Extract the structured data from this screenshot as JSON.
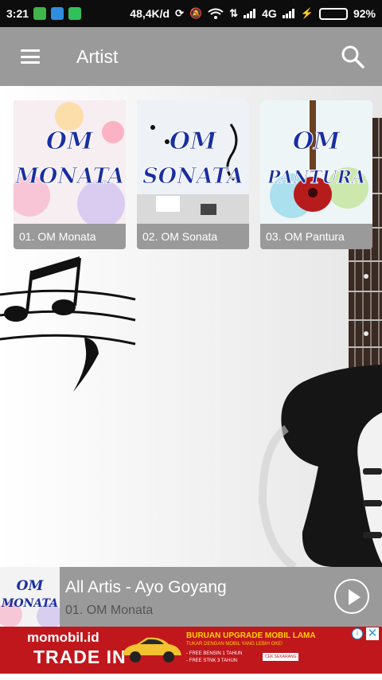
{
  "status_bar": {
    "time": "3:21",
    "speed": "48,4K/d",
    "network": "4G",
    "battery_percent": "92%",
    "battery_level": 0.92
  },
  "app_bar": {
    "title": "Artist",
    "menu_icon": "hamburger-menu-icon",
    "search_icon": "search-icon"
  },
  "artists": [
    {
      "label": "01. OM Monata",
      "art_line1": "OM",
      "art_line2": "MONATA",
      "art_bg": "#f7eef2"
    },
    {
      "label": "02. OM Sonata",
      "art_line1": "OM",
      "art_line2": "SONATA",
      "art_bg": "#eef2f7"
    },
    {
      "label": "03. OM Pantura",
      "art_line1": "OM",
      "art_line2": "PANTURA",
      "art_bg": "#eef5f7"
    }
  ],
  "now_playing": {
    "title": "All Artis - Ayo Goyang",
    "subtitle": "01. OM Monata",
    "thumb_line1": "OM",
    "thumb_line2": "MONATA",
    "play_icon": "play-icon"
  },
  "ad": {
    "brand": "momobil.id",
    "trade_text": "TRADE IN",
    "headline": "BURUAN UPGRADE MOBIL LAMA",
    "subheadline": "TUKAR DENGAN MOBIL YANG LEBIH OKE!",
    "bullet1": "- FREE BENSIN 1 TAHUN",
    "bullet2": "- FREE STNK 3 TAHUN",
    "cta": "CEK SEKARANG",
    "info_icon": "ad-info-icon",
    "close_icon": "ad-close-icon"
  },
  "colors": {
    "app_bar": "#9a9a9a",
    "ad_red": "#c0171c",
    "logo_blue": "#1a2fa0",
    "battery_green": "#34d24a"
  }
}
